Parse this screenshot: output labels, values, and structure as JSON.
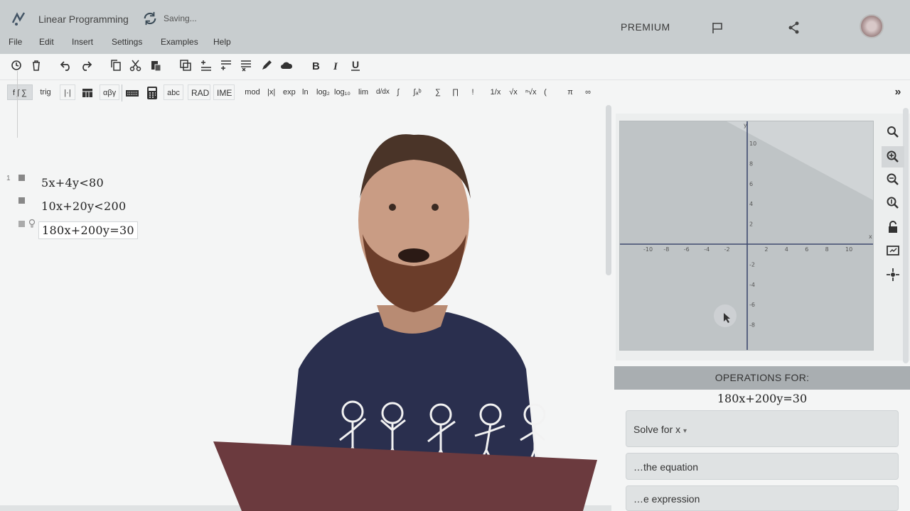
{
  "header": {
    "app_title": "Linear Programming",
    "save_status": "Saving...",
    "premium": "PREMIUM"
  },
  "menu": [
    "File",
    "Edit",
    "Insert",
    "Settings",
    "Examples",
    "Help"
  ],
  "toolbar2": {
    "func": "f ∫ ∑",
    "trig": "trig",
    "abs": "|·|",
    "greek": "αβγ",
    "abc": "abc",
    "rad": "RAD",
    "ime": "IME",
    "mod": "mod",
    "absx": "|x|",
    "exp": "exp",
    "ln": "ln",
    "log2": "log₂",
    "log10": "log₁₀",
    "lim": "lim",
    "deriv": "d/dx",
    "integral": "∫",
    "defint": "∫ₐᵇ",
    "sum": "∑",
    "prod": "∏",
    "fact": "!",
    "recip": "1/x",
    "sqrt": "√x",
    "nroot": "ⁿ√x",
    "paren": "(",
    "pi": "π",
    "inf": "∞",
    "more": "»"
  },
  "editor": {
    "line_number": "1",
    "equations": [
      "5x+4y<80",
      "10x+20y<200",
      "180x+200y=30"
    ]
  },
  "graph": {
    "x_ticks": [
      "-10",
      "-8",
      "-6",
      "-4",
      "-2",
      "2",
      "4",
      "6",
      "8",
      "10"
    ],
    "y_ticks_pos": [
      "10",
      "8",
      "6",
      "4",
      "2"
    ],
    "y_ticks_neg": [
      "-2",
      "-4",
      "-6",
      "-8"
    ],
    "x_label": "x",
    "y_label": "y"
  },
  "operations": {
    "header": "OPERATIONS FOR:",
    "equation": "180x+200y=30",
    "solve": "Solve for x",
    "op2": "…the equation",
    "op3": "…e expression"
  },
  "colors": {
    "titlebar": "#c8cdcf",
    "graph_bg": "#c4c9cb",
    "region_light": "#b9bec1",
    "ops_header": "#a9aeb1"
  }
}
